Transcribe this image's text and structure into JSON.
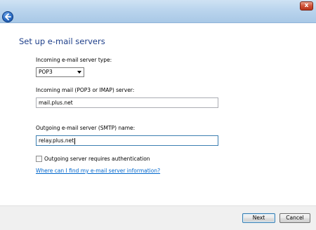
{
  "window": {
    "close_glyph": "x",
    "back_icon": "back-arrow-icon"
  },
  "page": {
    "heading": "Set up e-mail servers"
  },
  "incoming_type": {
    "label": "Incoming e-mail server type:",
    "selected": "POP3"
  },
  "incoming_server": {
    "label": "Incoming mail (POP3 or IMAP) server:",
    "value": "mail.plus.net"
  },
  "outgoing_server": {
    "label": "Outgoing e-mail server (SMTP) name:",
    "value": "relay.plus.net"
  },
  "auth": {
    "label": "Outgoing server requires authentication",
    "checked": false
  },
  "help_link": "Where can I find my e-mail server information?",
  "buttons": {
    "next": "Next",
    "cancel": "Cancel"
  },
  "colors": {
    "heading": "#1e3f8a",
    "link": "#0066cc",
    "titlebar": "#bcd6ee"
  }
}
